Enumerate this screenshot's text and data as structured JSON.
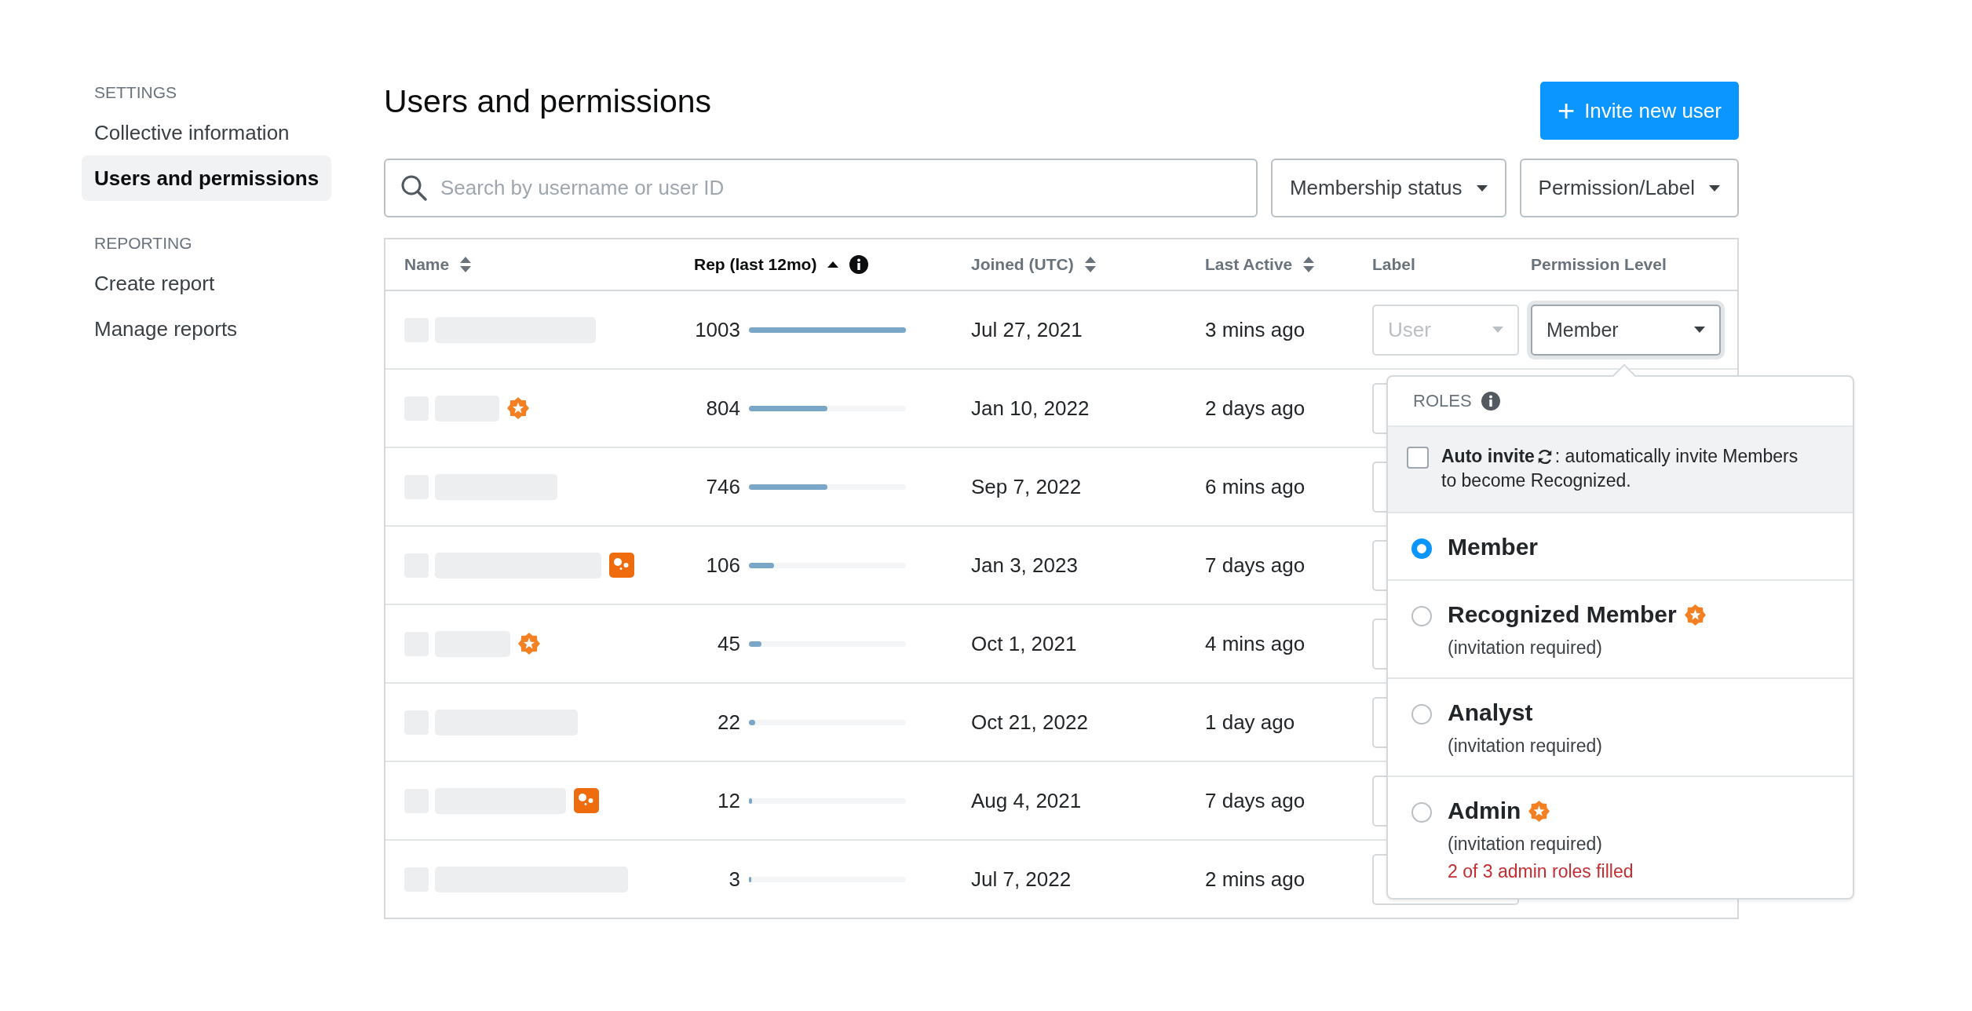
{
  "sidebar": {
    "sections": [
      {
        "heading": "SETTINGS",
        "items": [
          {
            "label": "Collective information",
            "selected": false
          },
          {
            "label": "Users and permissions",
            "selected": true
          }
        ]
      },
      {
        "heading": "REPORTING",
        "items": [
          {
            "label": "Create report",
            "selected": false
          },
          {
            "label": "Manage reports",
            "selected": false
          }
        ]
      }
    ]
  },
  "page": {
    "title": "Users and permissions",
    "invite_button": {
      "icon": "+",
      "label": "Invite new user"
    }
  },
  "filters": {
    "search": {
      "placeholder": "Search by username or user ID"
    },
    "dropdowns": [
      "Membership status",
      "Permission/Label"
    ]
  },
  "table": {
    "columns": [
      {
        "label": "Name",
        "sortable": true,
        "sorted": false,
        "info": false
      },
      {
        "label": "Rep (last 12mo)",
        "sortable": true,
        "sorted": true,
        "info": true
      },
      {
        "label": "Joined (UTC)",
        "sortable": true,
        "sorted": false,
        "info": false
      },
      {
        "label": "Last Active",
        "sortable": true,
        "sorted": false,
        "info": false
      },
      {
        "label": "Label",
        "sortable": false,
        "sorted": false,
        "info": false
      },
      {
        "label": "Permission Level",
        "sortable": false,
        "sorted": false,
        "info": false
      }
    ],
    "rows": [
      {
        "rep": "1003",
        "level": 1.0,
        "star_badge": false,
        "bot_badge": false,
        "joined": "Jul 27, 2021",
        "last_active": "3 mins ago",
        "label_select": {
          "placeholder": "User"
        },
        "permission_select": {
          "value": "Member",
          "focused": true
        }
      },
      {
        "rep": "804",
        "level": 0.5,
        "star_badge": true,
        "bot_badge": false,
        "joined": "Jan 10, 2022",
        "last_active": "2 days ago"
      },
      {
        "rep": "746",
        "level": 0.5,
        "star_badge": false,
        "bot_badge": false,
        "joined": "Sep 7, 2022",
        "last_active": "6 mins ago"
      },
      {
        "rep": "106",
        "level": 0.16,
        "star_badge": false,
        "bot_badge": true,
        "joined": "Jan 3, 2023",
        "last_active": "7 days ago"
      },
      {
        "rep": "45",
        "level": 0.08,
        "star_badge": true,
        "bot_badge": false,
        "joined": "Oct 1, 2021",
        "last_active": "4 mins ago"
      },
      {
        "rep": "22",
        "level": 0.04,
        "star_badge": false,
        "bot_badge": false,
        "joined": "Oct 21, 2022",
        "last_active": "1 day ago"
      },
      {
        "rep": "12",
        "level": 0.02,
        "star_badge": false,
        "bot_badge": true,
        "joined": "Aug 4, 2021",
        "last_active": "7 days ago"
      },
      {
        "rep": "3",
        "level": 0.015,
        "star_badge": false,
        "bot_badge": false,
        "joined": "Jul 7, 2022",
        "last_active": "2 mins ago"
      }
    ]
  },
  "roles_popup": {
    "heading": "ROLES",
    "auto_invite": {
      "checked": false,
      "label": "Auto invite",
      "text": ": automatically invite Members",
      "text_line_2": "to become Recognized."
    },
    "roles": [
      {
        "name": "Member",
        "selected": true,
        "badge": false
      },
      {
        "name": "Recognized Member",
        "selected": false,
        "badge": true,
        "note": "(invitation required)"
      },
      {
        "name": "Analyst",
        "selected": false,
        "badge": false,
        "note": "(invitation required)"
      },
      {
        "name": "Admin",
        "selected": false,
        "badge": true,
        "note": "(invitation required)",
        "warning": "2 of 3 admin roles filled"
      }
    ]
  }
}
